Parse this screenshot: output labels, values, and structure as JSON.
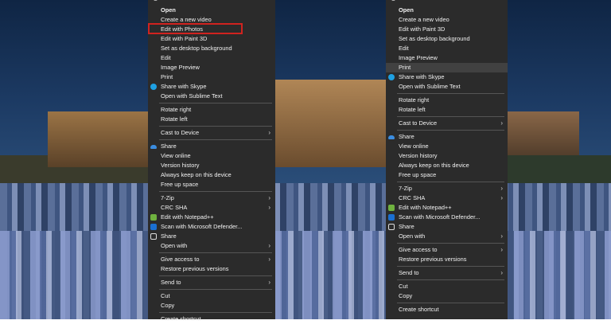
{
  "left_menu": {
    "items": [
      {
        "label": "Open",
        "bold": true
      },
      {
        "label": "Create a new video"
      },
      {
        "label": "Edit with Photos"
      },
      {
        "label": "Edit with Paint 3D"
      },
      {
        "label": "Set as desktop background"
      },
      {
        "label": "Edit"
      },
      {
        "label": "Image Preview"
      },
      {
        "label": "Print"
      },
      {
        "label": "Share with Skype",
        "icon": "skype-icon"
      },
      {
        "label": "Open with Sublime Text"
      },
      {
        "sep": true
      },
      {
        "label": "Rotate right"
      },
      {
        "label": "Rotate left"
      },
      {
        "sep": true
      },
      {
        "label": "Cast to Device",
        "arrow": true
      },
      {
        "sep": true
      },
      {
        "label": "Share",
        "icon": "onedrive-cloud-icon"
      },
      {
        "label": "View online"
      },
      {
        "label": "Version history"
      },
      {
        "label": "Always keep on this device"
      },
      {
        "label": "Free up space"
      },
      {
        "sep": true
      },
      {
        "label": "7-Zip",
        "arrow": true
      },
      {
        "label": "CRC SHA",
        "arrow": true
      },
      {
        "label": "Edit with Notepad++",
        "icon": "notepad-plus-plus-icon"
      },
      {
        "label": "Scan with Microsoft Defender...",
        "icon": "defender-shield-icon"
      },
      {
        "label": "Share",
        "icon": "share-icon"
      },
      {
        "label": "Open with",
        "arrow": true
      },
      {
        "sep": true
      },
      {
        "label": "Give access to",
        "arrow": true
      },
      {
        "label": "Restore previous versions"
      },
      {
        "sep": true
      },
      {
        "label": "Send to",
        "arrow": true
      },
      {
        "sep": true
      },
      {
        "label": "Cut"
      },
      {
        "label": "Copy"
      },
      {
        "sep": true
      },
      {
        "label": "Create shortcut"
      }
    ]
  },
  "right_menu": {
    "items": [
      {
        "label": "Open",
        "bold": true
      },
      {
        "label": "Create a new video"
      },
      {
        "label": "Edit with Paint 3D"
      },
      {
        "label": "Set as desktop background"
      },
      {
        "label": "Edit"
      },
      {
        "label": "Image Preview"
      },
      {
        "label": "Print",
        "hover": true
      },
      {
        "label": "Share with Skype",
        "icon": "skype-icon"
      },
      {
        "label": "Open with Sublime Text"
      },
      {
        "sep": true
      },
      {
        "label": "Rotate right"
      },
      {
        "label": "Rotate left"
      },
      {
        "sep": true
      },
      {
        "label": "Cast to Device",
        "arrow": true
      },
      {
        "sep": true
      },
      {
        "label": "Share",
        "icon": "onedrive-cloud-icon"
      },
      {
        "label": "View online"
      },
      {
        "label": "Version history"
      },
      {
        "label": "Always keep on this device"
      },
      {
        "label": "Free up space"
      },
      {
        "sep": true
      },
      {
        "label": "7-Zip",
        "arrow": true
      },
      {
        "label": "CRC SHA",
        "arrow": true
      },
      {
        "label": "Edit with Notepad++",
        "icon": "notepad-plus-plus-icon"
      },
      {
        "label": "Scan with Microsoft Defender...",
        "icon": "defender-shield-icon"
      },
      {
        "label": "Share",
        "icon": "share-icon"
      },
      {
        "label": "Open with",
        "arrow": true
      },
      {
        "sep": true
      },
      {
        "label": "Give access to",
        "arrow": true
      },
      {
        "label": "Restore previous versions"
      },
      {
        "sep": true
      },
      {
        "label": "Send to",
        "arrow": true
      },
      {
        "sep": true
      },
      {
        "label": "Cut"
      },
      {
        "label": "Copy"
      },
      {
        "sep": true
      },
      {
        "label": "Create shortcut"
      }
    ]
  },
  "arrow_glyph": "›",
  "colors": {
    "menu_bg": "#2b2b2b",
    "menu_text": "#f2f2f2",
    "highlight_border": "#d0231f",
    "hover_bg": "#414141"
  }
}
